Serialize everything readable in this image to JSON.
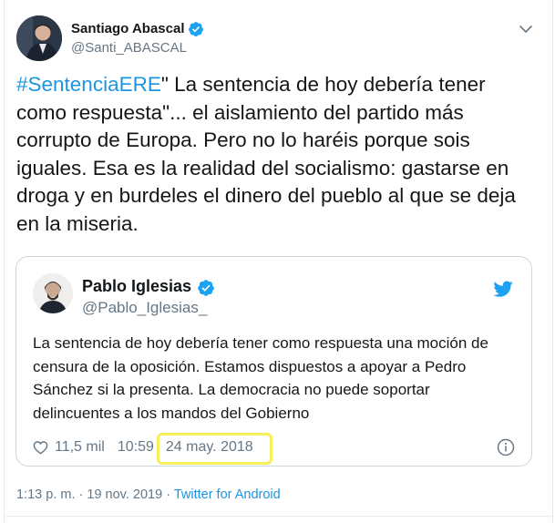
{
  "tweet": {
    "author": {
      "name": "Santiago Abascal",
      "handle": "@Santi_ABASCAL",
      "verified": true,
      "avatar_icon": "portrait-avatar"
    },
    "hashtag": "#SentenciaERE",
    "text_rest": "\" La sentencia de hoy debería tener como respuesta\"... el aislamiento del partido más corrupto de Europa. Pero no lo haréis porque sois iguales. Esa es la realidad del socialismo: gastarse en droga y en burdeles el dinero del pueblo al que se deja en la miseria.",
    "time": "1:13 p. m.",
    "separator": "·",
    "date": "19 nov. 2019",
    "source": "Twitter for Android",
    "caret_icon": "chevron-down-icon"
  },
  "quoted": {
    "author": {
      "name": "Pablo Iglesias",
      "handle": "@Pablo_Iglesias_",
      "verified": true,
      "avatar_icon": "portrait-avatar"
    },
    "text": "La sentencia de hoy debería tener como respuesta una moción de censura de la oposición. Estamos dispuestos a apoyar a Pedro Sánchez si la presenta. La democracia no puede soportar delincuentes a los mandos del Gobierno",
    "likes": "11,5 mil",
    "time": "10:59",
    "date": "24 may. 2018",
    "bird_icon": "twitter-bird-icon",
    "info_icon": "info-icon",
    "heart_icon": "heart-icon"
  },
  "colors": {
    "link": "#1b95e0",
    "verified": "#1da1f2",
    "secondary_text": "#657786",
    "border": "#ccd6dd",
    "highlight": "#f5ef5a"
  }
}
